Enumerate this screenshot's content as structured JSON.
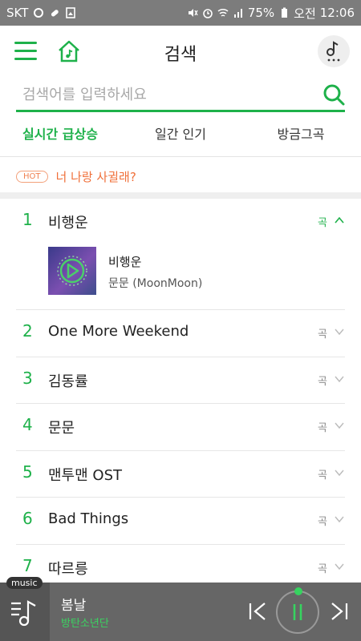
{
  "status_bar": {
    "carrier": "SKT",
    "battery": "75%",
    "ampm": "오전",
    "time": "12:06"
  },
  "header": {
    "title": "검색"
  },
  "search": {
    "placeholder": "검색어를 입력하세요"
  },
  "tabs": [
    {
      "label": "실시간 급상승",
      "active": true
    },
    {
      "label": "일간 인기",
      "active": false
    },
    {
      "label": "방금그곡",
      "active": false
    }
  ],
  "hot": {
    "badge": "HOT",
    "text": "너 나랑 사귈래?"
  },
  "chart": {
    "items": [
      {
        "rank": "1",
        "name": "비행운",
        "category": "곡",
        "expanded": true
      },
      {
        "rank": "2",
        "name": "One More Weekend",
        "category": "곡"
      },
      {
        "rank": "3",
        "name": "김동률",
        "category": "곡"
      },
      {
        "rank": "4",
        "name": "문문",
        "category": "곡"
      },
      {
        "rank": "5",
        "name": "맨투맨 OST",
        "category": "곡"
      },
      {
        "rank": "6",
        "name": "Bad Things",
        "category": "곡"
      },
      {
        "rank": "7",
        "name": "따르릉",
        "category": "곡"
      }
    ],
    "expanded": {
      "title": "비행운",
      "artist": "문문 (MoonMoon)"
    }
  },
  "player": {
    "tag": "music",
    "song": "봄날",
    "artist": "방탄소년단"
  },
  "colors": {
    "accent": "#1eb14a",
    "hot": "#f0703a",
    "player_bg": "#666666"
  }
}
